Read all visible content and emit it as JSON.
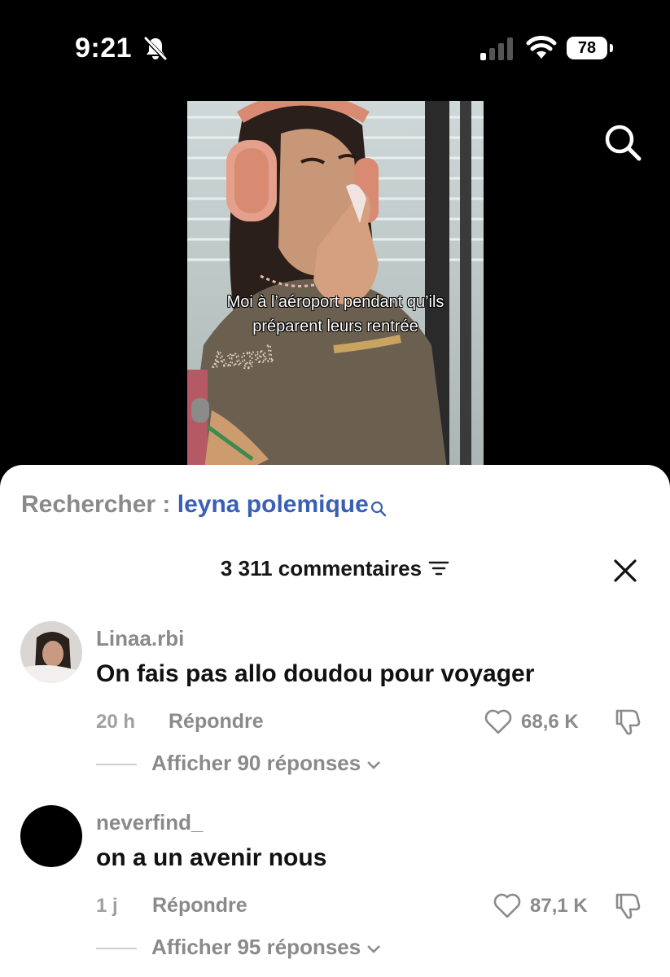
{
  "status_bar": {
    "time": "9:21",
    "battery": "78"
  },
  "video": {
    "caption_line1": "Moi à l’aéroport pendant qu’ils",
    "caption_line2": "préparent leurs rentrée"
  },
  "search_suggestion": {
    "prefix": "Rechercher : ",
    "term": "leyna polemique"
  },
  "comments_header": {
    "title": "3 311 commentaires"
  },
  "comments": [
    {
      "username": "Linaa.rbi",
      "text": "On fais pas allo doudou pour voyager",
      "time": "20 h",
      "reply_label": "Répondre",
      "likes": "68,6 K",
      "show_replies": "Afficher 90 réponses"
    },
    {
      "username": "neverfind_",
      "text": "on a un avenir nous",
      "time": "1 j",
      "reply_label": "Répondre",
      "likes": "87,1 K",
      "show_replies": "Afficher 95 réponses"
    }
  ],
  "colors": {
    "accent_blue": "#3a5fb5",
    "muted_gray": "#8a8a8a",
    "sheet_bg": "#ffffff",
    "top_bg": "#000000"
  },
  "icons": [
    "bell-slash-icon",
    "cellular-signal-icon",
    "wifi-icon",
    "battery-icon",
    "search-icon",
    "filter-icon",
    "close-icon",
    "heart-icon",
    "thumbs-down-icon",
    "chevron-down-icon"
  ]
}
